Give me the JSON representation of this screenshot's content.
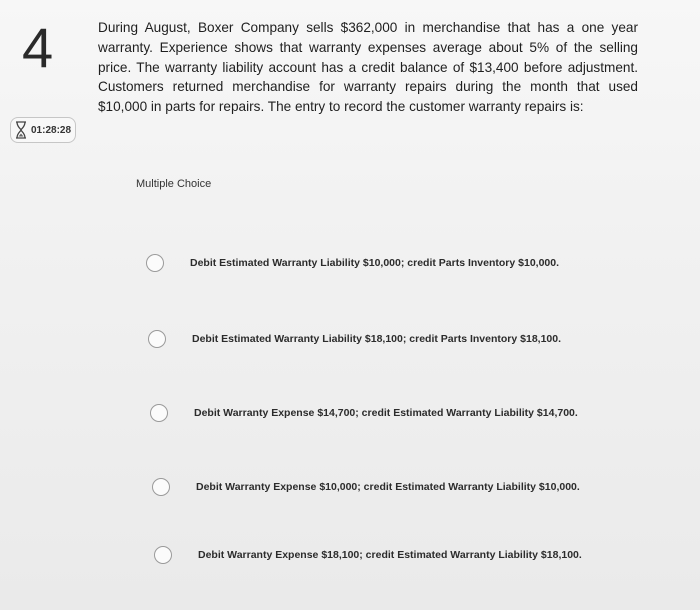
{
  "question": {
    "number": "4",
    "timer": "01:28:28",
    "text": "During August, Boxer Company sells $362,000 in merchandise that has a one year warranty. Experience shows that warranty expenses average about 5% of the selling price. The warranty liability account has a credit balance of $13,400 before adjustment. Customers returned merchandise for warranty repairs during the month that used $10,000 in parts for repairs. The entry to record the customer warranty repairs is:"
  },
  "answers": {
    "type_label": "Multiple Choice",
    "options": [
      {
        "label": "Debit Estimated Warranty Liability $10,000; credit Parts Inventory $10,000."
      },
      {
        "label": "Debit Estimated Warranty Liability $18,100; credit Parts Inventory $18,100."
      },
      {
        "label": "Debit Warranty Expense $14,700; credit Estimated Warranty Liability $14,700."
      },
      {
        "label": "Debit Warranty Expense $10,000; credit Estimated Warranty Liability $10,000."
      },
      {
        "label": "Debit Warranty Expense $18,100; credit Estimated Warranty Liability $18,100."
      }
    ]
  },
  "icons": {
    "timer": "hourglass-icon"
  }
}
